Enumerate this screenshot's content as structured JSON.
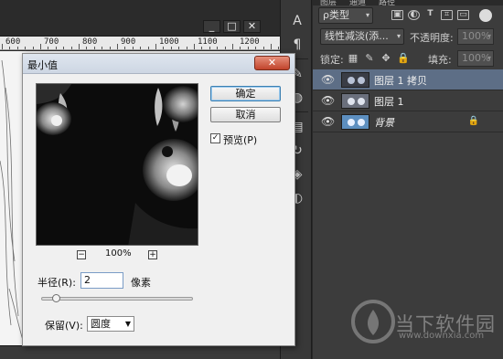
{
  "document": {
    "window_buttons": {
      "minimize": "_",
      "restore": "□",
      "close": "✕"
    },
    "ruler_labels": [
      "600",
      "700",
      "800",
      "900",
      "1000",
      "1100",
      "1200"
    ]
  },
  "tools": [
    {
      "name": "character-icon",
      "glyph": "A"
    },
    {
      "name": "paragraph-icon",
      "glyph": "¶"
    },
    {
      "name": "brush-icon",
      "glyph": "✎"
    },
    {
      "name": "stamp-icon",
      "glyph": "◍"
    },
    {
      "name": "list-icon",
      "glyph": "▤"
    },
    {
      "name": "history-icon",
      "glyph": "↻"
    },
    {
      "name": "cube-icon",
      "glyph": "◈"
    },
    {
      "name": "adjust-icon",
      "glyph": "◐"
    }
  ],
  "layers_panel": {
    "tabs": [
      "图层",
      "通道",
      "路径"
    ],
    "filter_label": "ρ类型",
    "blend_mode": "线性减淡(添...",
    "opacity_label": "不透明度:",
    "opacity_value": "100%",
    "lock_label": "锁定:",
    "fill_label": "填充:",
    "fill_value": "100%",
    "layers": [
      {
        "name": "图层 1 拷贝",
        "selected": true,
        "italic": false,
        "locked": false
      },
      {
        "name": "图层 1",
        "selected": false,
        "italic": false,
        "locked": false
      },
      {
        "name": "背景",
        "selected": false,
        "italic": true,
        "locked": true
      }
    ]
  },
  "dialog": {
    "title": "最小值",
    "close_label": "✕",
    "ok_label": "确定",
    "cancel_label": "取消",
    "preview_label": "预览(P)",
    "preview_checked": true,
    "zoom_minus": "−",
    "zoom_plus": "+",
    "zoom_value": "100%",
    "radius_label": "半径(R):",
    "radius_value": "2",
    "radius_unit": "像素",
    "radius_level": 0.05,
    "preserve_label": "保留(V):",
    "preserve_value": "圆度"
  },
  "watermark": {
    "text": "当下软件园",
    "url": "www.downxia.com"
  },
  "colors": {
    "selected_layer": "#5d6e86",
    "panel_bg": "#3c3c3c",
    "dialog_bg": "#f0f0f0",
    "close_red": "#c1432b"
  }
}
